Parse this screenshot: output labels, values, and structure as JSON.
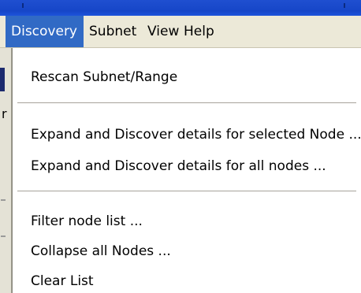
{
  "menubar": {
    "items": [
      {
        "label": "Discovery",
        "active": true
      },
      {
        "label": "Subnet",
        "active": false
      },
      {
        "label": "View",
        "active": false
      },
      {
        "label": "Help",
        "active": false
      }
    ]
  },
  "dropdown": {
    "items": [
      {
        "label": "Rescan Subnet/Range"
      },
      {
        "label": "Expand and Discover details for selected Node ..."
      },
      {
        "label": "Expand and Discover details for all nodes ..."
      },
      {
        "label": "Filter node list ..."
      },
      {
        "label": "Collapse all Nodes ..."
      },
      {
        "label": "Clear List"
      }
    ]
  },
  "background_window": {
    "partial_glyph": "r"
  },
  "colors": {
    "titlebar": "#1646c8",
    "menubar": "#ece9d8",
    "highlight": "#316ac5"
  }
}
